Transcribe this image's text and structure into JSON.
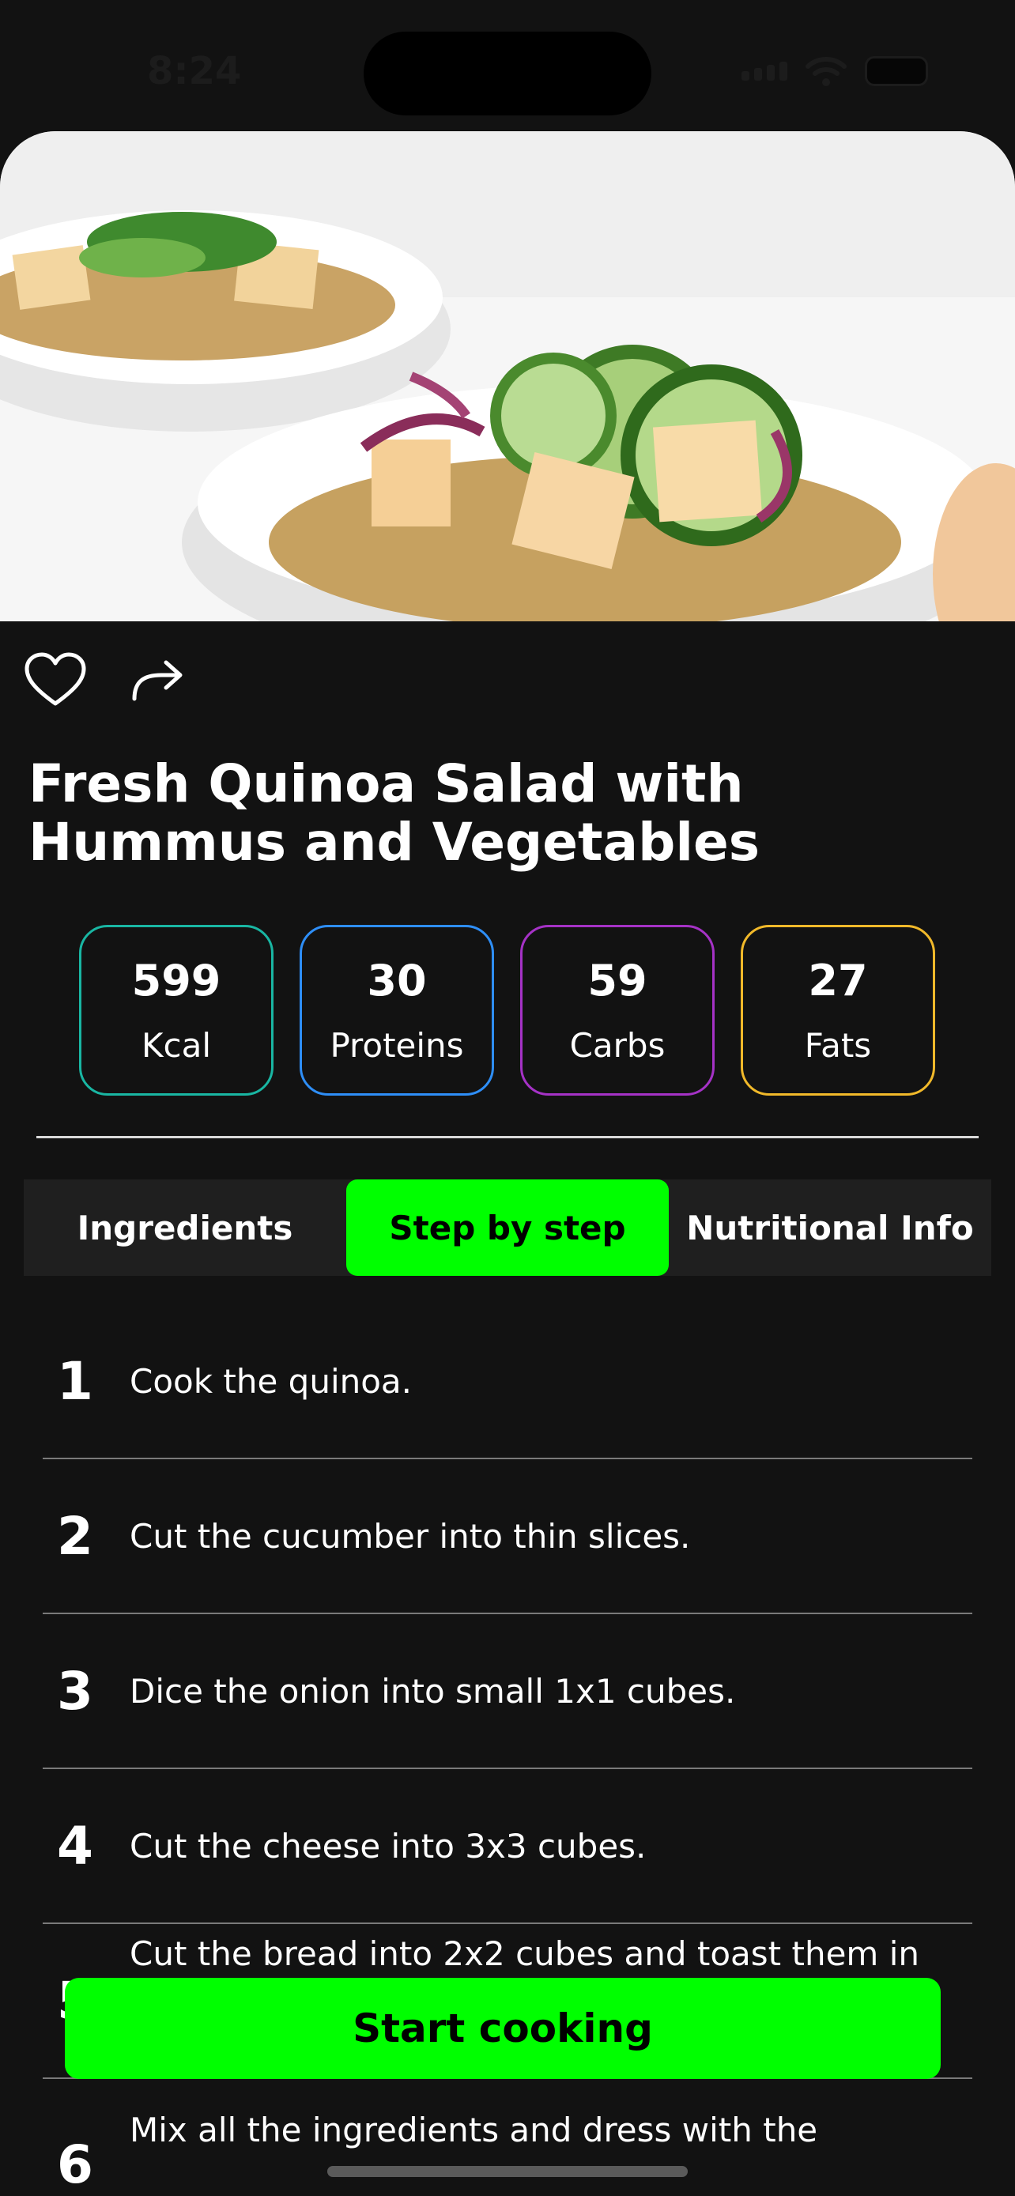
{
  "status_bar": {
    "time": "8:24"
  },
  "recipe": {
    "title": "Fresh Quinoa Salad with Hummus and Vegetables"
  },
  "actions": {
    "favorite_icon": "heart-icon",
    "share_icon": "share-arrow-icon"
  },
  "macros": [
    {
      "value": "599",
      "label": "Kcal",
      "color": "#19b6a3"
    },
    {
      "value": "30",
      "label": "Proteins",
      "color": "#2e8ef7"
    },
    {
      "value": "59",
      "label": "Carbs",
      "color": "#a532c6"
    },
    {
      "value": "27",
      "label": "Fats",
      "color": "#f1b92a"
    }
  ],
  "tabs": [
    {
      "label": "Ingredients",
      "active": false
    },
    {
      "label": "Step by step",
      "active": true
    },
    {
      "label": "Nutritional Info",
      "active": false
    }
  ],
  "steps": [
    {
      "num": "1",
      "text": "Cook the quinoa."
    },
    {
      "num": "2",
      "text": "Cut the cucumber into thin slices."
    },
    {
      "num": "3",
      "text": "Dice the onion into small 1x1 cubes."
    },
    {
      "num": "4",
      "text": "Cut the cheese into 3x3 cubes."
    },
    {
      "num": "5",
      "text": "Cut the bread into 2x2 cubes and toast them in"
    },
    {
      "num": "6",
      "text": "Mix all the ingredients and dress with the"
    }
  ],
  "cta": {
    "label": "Start cooking"
  },
  "colors": {
    "accent": "#00ff00",
    "background": "#121212"
  }
}
